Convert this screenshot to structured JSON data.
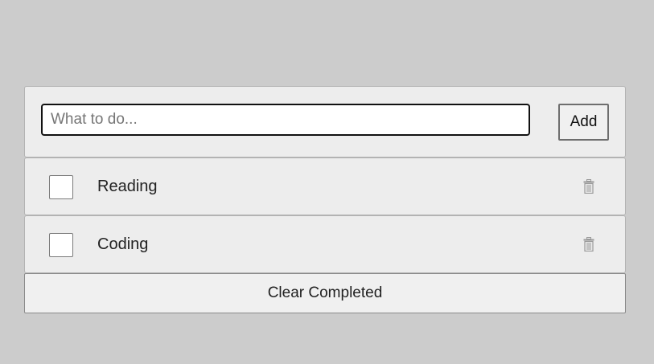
{
  "new_todo": {
    "placeholder": "What to do...",
    "value": "",
    "add_label": "Add"
  },
  "todos": [
    {
      "label": "Reading",
      "completed": false,
      "delete_icon": "trash-icon"
    },
    {
      "label": "Coding",
      "completed": false,
      "delete_icon": "trash-icon"
    }
  ],
  "footer": {
    "clear_label": "Clear Completed"
  },
  "colors": {
    "background": "#cccccc",
    "panel": "#ededed",
    "icon": "#9a9a9a"
  }
}
